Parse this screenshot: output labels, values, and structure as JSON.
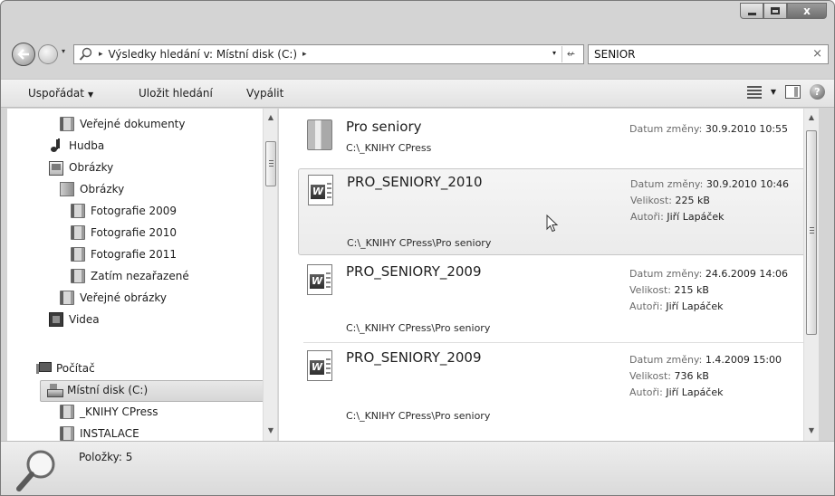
{
  "window": {
    "caption_buttons": [
      "minimize",
      "maximize",
      "close"
    ],
    "close_glyph": "x"
  },
  "address_bar": {
    "path_text": "Výsledky hledání v: Místní disk (C:)",
    "separator": "▸",
    "separator_end": "▸",
    "dropdown_glyph": "▾",
    "refresh_glyph": "↚"
  },
  "search": {
    "value": "SENIOR",
    "clear_glyph": "×"
  },
  "toolbar": {
    "organize_label": "Uspořádat",
    "organize_arrow": "▼",
    "save_search_label": "Uložit hledání",
    "burn_label": "Vypálit",
    "view_arrow": "▼",
    "help_glyph": "?"
  },
  "navigation": {
    "items": [
      {
        "label": "Veřejné dokumenty",
        "icon": "folder-icon"
      },
      {
        "label": "Hudba",
        "icon": "music-icon"
      },
      {
        "label": "Obrázky",
        "icon": "pictures-library-icon"
      },
      {
        "label": "Obrázky",
        "icon": "library-folder-icon"
      },
      {
        "label": "Fotografie 2009",
        "icon": "folder-icon"
      },
      {
        "label": "Fotografie 2010",
        "icon": "folder-icon"
      },
      {
        "label": "Fotografie 2011",
        "icon": "folder-icon"
      },
      {
        "label": "Zatím nezařazené",
        "icon": "folder-icon"
      },
      {
        "label": "Veřejné obrázky",
        "icon": "folder-icon"
      },
      {
        "label": "Videa",
        "icon": "video-icon"
      },
      {
        "label": "Počítač",
        "icon": "computer-icon"
      },
      {
        "label": "Místní disk (C:)",
        "icon": "drive-icon",
        "selected": true
      },
      {
        "label": "_KNIHY CPress",
        "icon": "folder-icon"
      },
      {
        "label": "INSTALACE",
        "icon": "folder-icon"
      }
    ]
  },
  "results": {
    "date_label": "Datum změny:",
    "size_label": "Velikost:",
    "author_label": "Autoři:",
    "items": [
      {
        "name": "Pro seniory",
        "path": "C:\\_KNIHY CPress",
        "date": "30.9.2010 10:55",
        "icon": "folder-icon"
      },
      {
        "name": "PRO_SENIORY_2010",
        "path": "C:\\_KNIHY CPress\\Pro seniory",
        "date": "30.9.2010 10:46",
        "size": "225 kB",
        "author": "Jiří Lapáček",
        "icon": "word-document-icon",
        "hovered": true
      },
      {
        "name": "PRO_SENIORY_2009",
        "path": "C:\\_KNIHY CPress\\Pro seniory",
        "date": "24.6.2009 14:06",
        "size": "215 kB",
        "author": "Jiří Lapáček",
        "icon": "word-document-icon"
      },
      {
        "name": "PRO_SENIORY_2009",
        "path": "C:\\_KNIHY CPress\\Pro seniory",
        "date": "1.4.2009 15:00",
        "size": "736 kB",
        "author": "Jiří Lapáček",
        "icon": "word-document-icon"
      }
    ]
  },
  "scroll": {
    "up_glyph": "▲",
    "down_glyph": "▼"
  },
  "status": {
    "items_text": "Položky: 5"
  }
}
